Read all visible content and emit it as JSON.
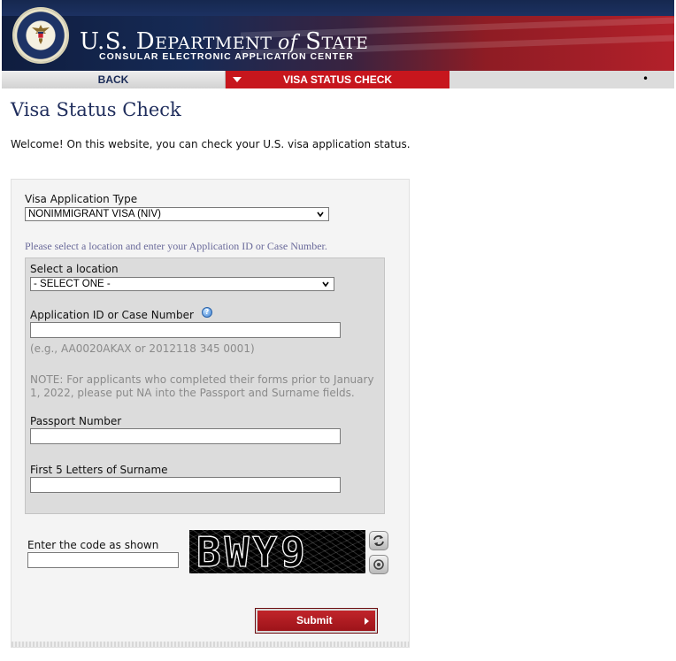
{
  "header": {
    "dept_prefix": "U.S. D",
    "dept_part1": "EPARTMENT ",
    "dept_of": "of",
    "dept_part2": " S",
    "dept_part3": "TATE",
    "subtitle": "CONSULAR ELECTRONIC APPLICATION CENTER",
    "seal_text": "DEPARTMENT OF STATE • UNITED STATES OF AMERICA"
  },
  "nav": {
    "back_label": "BACK",
    "active_label": "VISA STATUS CHECK",
    "dot": "•"
  },
  "page": {
    "title": "Visa Status Check",
    "welcome": "Welcome! On this website, you can check your U.S. visa application status."
  },
  "form": {
    "app_type_label": "Visa Application Type",
    "app_type_value": "NONIMMIGRANT VISA (NIV)",
    "hint": "Please select a location and enter your Application ID or Case Number.",
    "location_label": "Select a location",
    "location_value": "- SELECT ONE -",
    "appid_label": "Application ID or Case Number",
    "appid_value": "",
    "appid_example": "(e.g., AA0020AKAX or 2012118 345 0001)",
    "note_line1": "NOTE: For applicants who completed their forms prior to January",
    "note_line2": "1, 2022, please put NA into the Passport and Surname fields.",
    "passport_label": "Passport Number",
    "passport_value": "",
    "surname_label": "First 5 Letters of Surname",
    "surname_value": "",
    "captcha_label": "Enter the code as shown",
    "captcha_value": "",
    "captcha_code": "BWY9",
    "submit_label": "Submit"
  },
  "colors": {
    "accent_red": "#c7161d",
    "navy": "#1f2d5c"
  },
  "icons": [
    "seal-icon",
    "chevron-down-icon",
    "help-icon",
    "refresh-icon",
    "audio-icon",
    "arrow-right-icon"
  ]
}
